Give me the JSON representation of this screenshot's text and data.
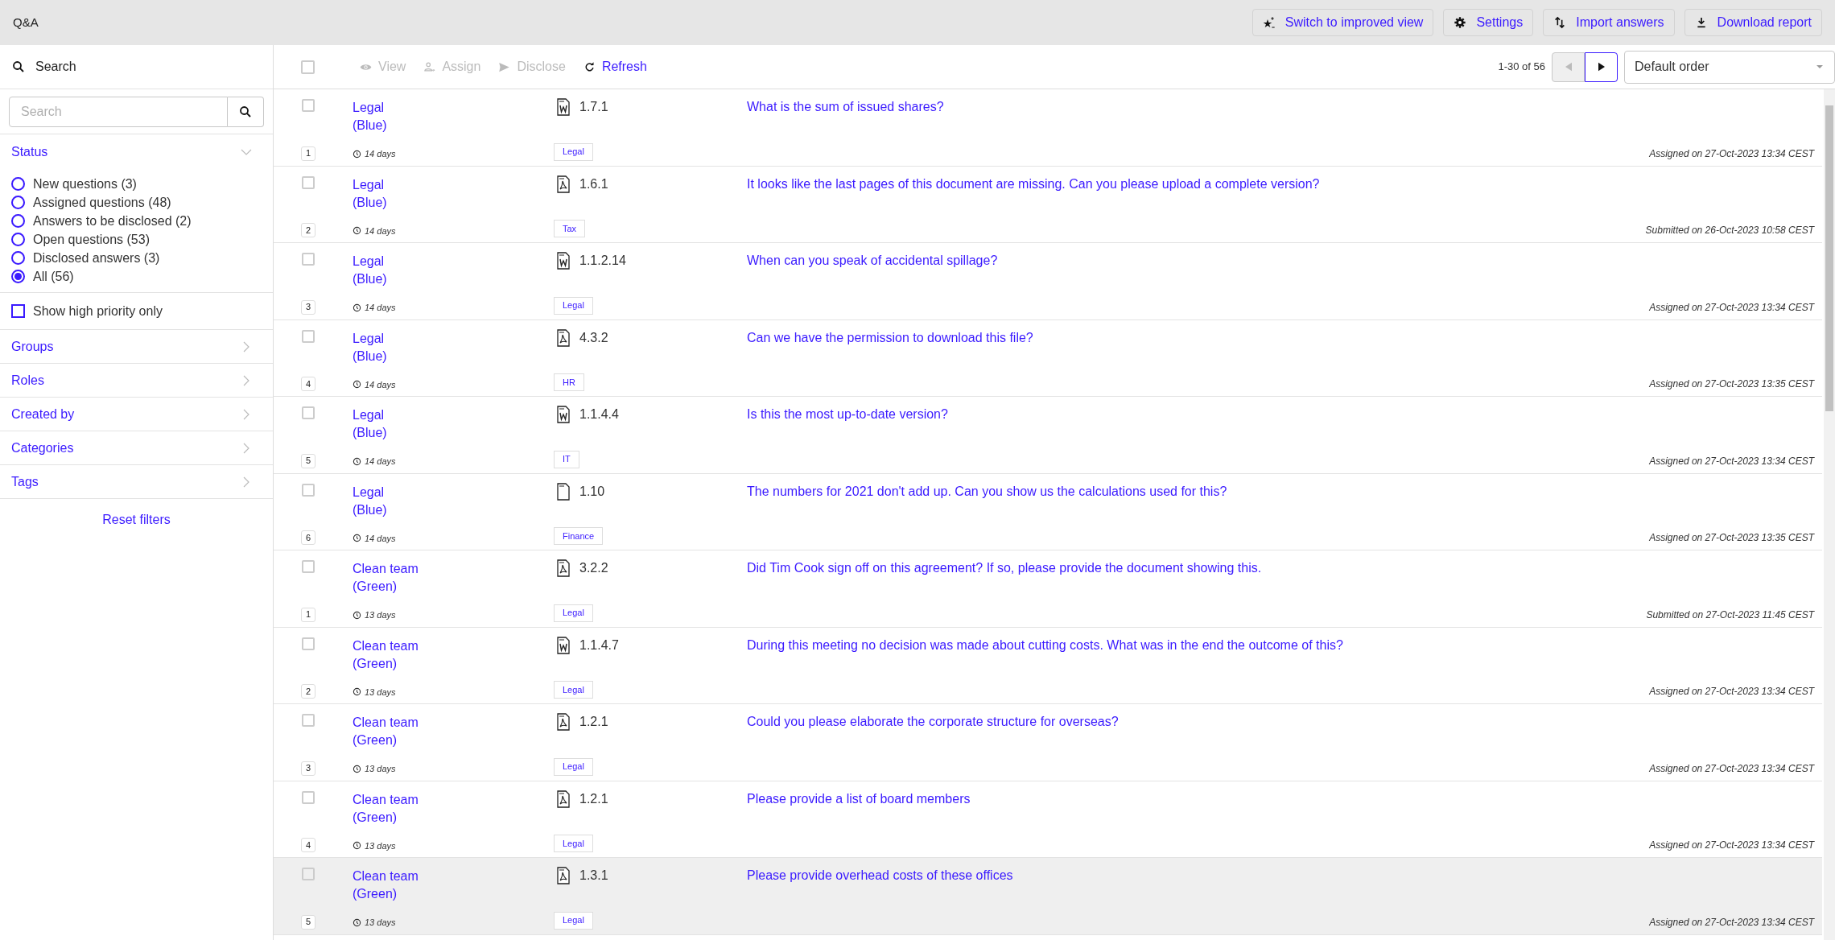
{
  "app_title": "Q&A",
  "top_actions": [
    {
      "kind": "improved",
      "label": "Switch to improved view"
    },
    {
      "kind": "settings",
      "label": "Settings"
    },
    {
      "kind": "import",
      "label": "Import answers"
    },
    {
      "kind": "download",
      "label": "Download report"
    }
  ],
  "sidebar": {
    "search_heading": "Search",
    "search": {
      "placeholder": "Search"
    },
    "status": {
      "title": "Status",
      "expanded": true,
      "options": [
        {
          "label": "New questions (3)",
          "selected": false
        },
        {
          "label": "Assigned questions (48)",
          "selected": false
        },
        {
          "label": "Answers to be disclosed (2)",
          "selected": false
        },
        {
          "label": "Open questions (53)",
          "selected": false
        },
        {
          "label": "Disclosed answers (3)",
          "selected": false
        },
        {
          "label": "All (56)",
          "selected": true
        }
      ]
    },
    "high_priority": {
      "label": "Show high priority only",
      "checked": false
    },
    "sections": [
      {
        "title": "Groups",
        "expanded": false
      },
      {
        "title": "Roles",
        "expanded": false
      },
      {
        "title": "Created by",
        "expanded": false
      },
      {
        "title": "Categories",
        "expanded": false
      },
      {
        "title": "Tags",
        "expanded": false
      }
    ],
    "reset": "Reset filters"
  },
  "toolbar": {
    "select_all": false,
    "actions": [
      {
        "kind": "view",
        "label": "View",
        "disabled": true
      },
      {
        "kind": "assign",
        "label": "Assign",
        "disabled": true
      },
      {
        "kind": "disclose",
        "label": "Disclose",
        "disabled": true
      },
      {
        "kind": "refresh",
        "label": "Refresh",
        "disabled": false
      }
    ],
    "range": "1-30 of 56",
    "prev_disabled": true,
    "next_disabled": false,
    "order": "Default order"
  },
  "rows": [
    {
      "checked": false,
      "hovered": false,
      "number": "1",
      "group": "Legal",
      "group_note": "(Blue)",
      "age": "14 days",
      "file": {
        "kind": "word"
      },
      "ref": "1.7.1",
      "tag": "Legal",
      "question": "What is the sum of issued shares?",
      "status": "Assigned on 27-Oct-2023 13:34 CEST"
    },
    {
      "checked": false,
      "hovered": false,
      "number": "2",
      "group": "Legal",
      "group_note": "(Blue)",
      "age": "14 days",
      "file": {
        "kind": "pdf"
      },
      "ref": "1.6.1",
      "tag": "Tax",
      "question": "It looks like the last pages of this document are missing. Can you please upload a complete version?",
      "status": "Submitted on 26-Oct-2023 10:58 CEST"
    },
    {
      "checked": false,
      "hovered": false,
      "number": "3",
      "group": "Legal",
      "group_note": "(Blue)",
      "age": "14 days",
      "file": {
        "kind": "word"
      },
      "ref": "1.1.2.14",
      "tag": "Legal",
      "question": "When can you speak of accidental spillage?",
      "status": "Assigned on 27-Oct-2023 13:34 CEST"
    },
    {
      "checked": false,
      "hovered": false,
      "number": "4",
      "group": "Legal",
      "group_note": "(Blue)",
      "age": "14 days",
      "file": {
        "kind": "pdf"
      },
      "ref": "4.3.2",
      "tag": "HR",
      "question": "Can we have the permission to download this file?",
      "status": "Assigned on 27-Oct-2023 13:35 CEST"
    },
    {
      "checked": false,
      "hovered": false,
      "number": "5",
      "group": "Legal",
      "group_note": "(Blue)",
      "age": "14 days",
      "file": {
        "kind": "word"
      },
      "ref": "1.1.4.4",
      "tag": "IT",
      "question": "Is this the most up-to-date version?",
      "status": "Assigned on 27-Oct-2023 13:34 CEST"
    },
    {
      "checked": false,
      "hovered": false,
      "number": "6",
      "group": "Legal",
      "group_note": "(Blue)",
      "age": "14 days",
      "file": {
        "kind": "blank"
      },
      "ref": "1.10",
      "tag": "Finance",
      "question": "The numbers for 2021 don't add up. Can you show us the calculations used for this?",
      "status": "Assigned on 27-Oct-2023 13:35 CEST"
    },
    {
      "checked": false,
      "hovered": false,
      "number": "1",
      "group": "Clean team",
      "group_note": "(Green)",
      "age": "13 days",
      "file": {
        "kind": "pdf"
      },
      "ref": "3.2.2",
      "tag": "Legal",
      "question": "Did Tim Cook sign off on this agreement? If so, please provide the document showing this.",
      "status": "Submitted on 27-Oct-2023 11:45 CEST"
    },
    {
      "checked": false,
      "hovered": false,
      "number": "2",
      "group": "Clean team",
      "group_note": "(Green)",
      "age": "13 days",
      "file": {
        "kind": "word"
      },
      "ref": "1.1.4.7",
      "tag": "Legal",
      "question": "During this meeting no decision was made about cutting costs. What was in the end the outcome of this?",
      "status": "Assigned on 27-Oct-2023 13:34 CEST"
    },
    {
      "checked": false,
      "hovered": false,
      "number": "3",
      "group": "Clean team",
      "group_note": "(Green)",
      "age": "13 days",
      "file": {
        "kind": "pdf"
      },
      "ref": "1.2.1",
      "tag": "Legal",
      "question": "Could you please elaborate the corporate structure for overseas?",
      "status": "Assigned on 27-Oct-2023 13:34 CEST"
    },
    {
      "checked": false,
      "hovered": false,
      "number": "4",
      "group": "Clean team",
      "group_note": "(Green)",
      "age": "13 days",
      "file": {
        "kind": "pdf"
      },
      "ref": "1.2.1",
      "tag": "Legal",
      "question": "Please provide a list of board members",
      "status": "Assigned on 27-Oct-2023 13:34 CEST"
    },
    {
      "checked": false,
      "hovered": true,
      "number": "5",
      "group": "Clean team",
      "group_note": "(Green)",
      "age": "13 days",
      "file": {
        "kind": "pdf"
      },
      "ref": "1.3.1",
      "tag": "Legal",
      "question": "Please provide overhead costs of these offices",
      "status": "Assigned on 27-Oct-2023 13:34 CEST"
    }
  ]
}
